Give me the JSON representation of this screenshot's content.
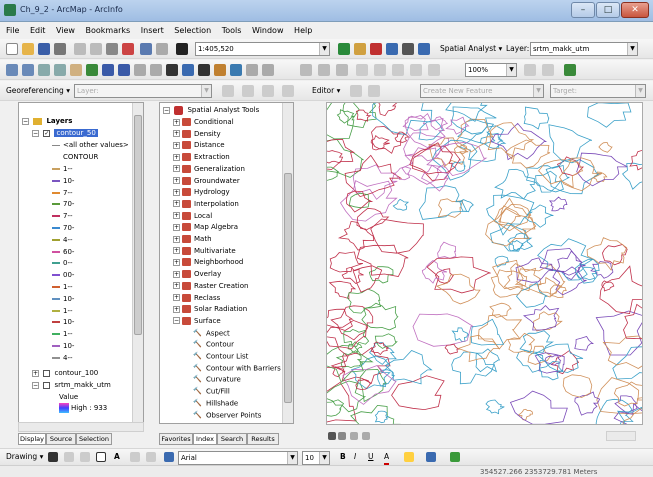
{
  "window": {
    "title": "Ch_9_2 - ArcMap - ArcInfo",
    "minimize": "–",
    "maximize": "□",
    "close": "✕"
  },
  "menu": [
    "File",
    "Edit",
    "View",
    "Bookmarks",
    "Insert",
    "Selection",
    "Tools",
    "Window",
    "Help"
  ],
  "toolbar1": {
    "scale": "1:405,520",
    "spatial_analyst": "Spatial Analyst ▾",
    "layer_label": "Layer:",
    "layer_value": "srtm_makk_utm"
  },
  "toolbar2": {
    "zoom": "100%"
  },
  "toolbar3": {
    "georeferencing": "Georeferencing ▾",
    "layer_combo": "Layer:",
    "editor": "Editor ▾",
    "create_feature": "Create New Feature",
    "target": "Target:"
  },
  "toc": {
    "layers_title": "Layers",
    "layer1": "contour_50",
    "all_other": "<all other values>",
    "field": "CONTOUR",
    "classes": [
      "1--",
      "10-",
      "7--",
      "70-",
      "7--",
      "70-",
      "4--",
      "60-",
      "0--",
      "00-",
      "1--",
      "10-",
      "1--",
      "10-",
      "1--",
      "10-",
      "4--"
    ],
    "class_colors": [
      "#c8a060",
      "#7a55c0",
      "#e08a30",
      "#5a9a3a",
      "#c03060",
      "#3a8ad0",
      "#a0a030",
      "#d050a0",
      "#40a090",
      "#8050d0",
      "#d06030",
      "#6090c0",
      "#b0b040",
      "#c04040",
      "#40b060",
      "#a060c0",
      "#909090"
    ],
    "layer2": "contour_100",
    "layer3": "srtm_makk_utm",
    "value_label": "Value",
    "high": "High : 933",
    "tabs": [
      "Display",
      "Source",
      "Selection"
    ]
  },
  "arctoolbox": {
    "root": "Spatial Analyst Tools",
    "items": [
      "Conditional",
      "Density",
      "Distance",
      "Extraction",
      "Generalization",
      "Groundwater",
      "Hydrology",
      "Interpolation",
      "Local",
      "Map Algebra",
      "Math",
      "Multivariate",
      "Neighborhood",
      "Overlay",
      "Raster Creation",
      "Reclass",
      "Solar Radiation",
      "Surface"
    ],
    "surface_tools": [
      "Aspect",
      "Contour",
      "Contour List",
      "Contour with Barriers",
      "Curvature",
      "Cut/Fill",
      "Hillshade",
      "Observer Points"
    ],
    "tabs": [
      "Favorites",
      "Index",
      "Search",
      "Results"
    ]
  },
  "drawing": {
    "label": "Drawing ▾",
    "font": "Arial",
    "size": "10",
    "bold": "B",
    "italic": "I",
    "underline": "U"
  },
  "status": {
    "coords": "354527.266  2353729.781 Meters"
  },
  "contour_colors": [
    "#3aa0c8",
    "#7a4ab8",
    "#d0905a",
    "#4aa04a",
    "#c0304a",
    "#c070c0",
    "#9a9a3a"
  ]
}
